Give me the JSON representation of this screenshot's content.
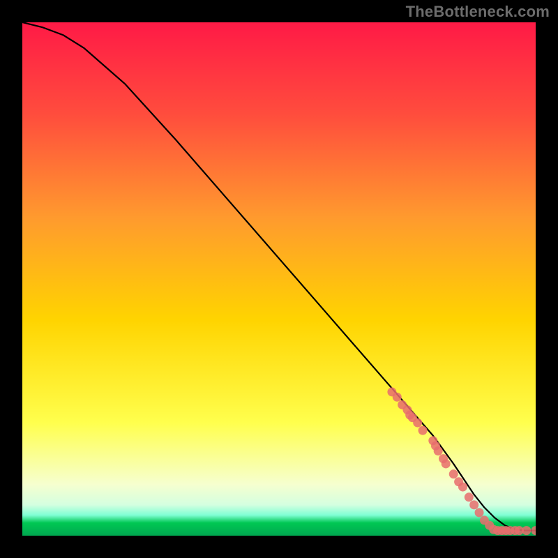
{
  "watermark": "TheBottleneck.com",
  "colors": {
    "background": "#000000",
    "watermark_text": "#6c6c6c",
    "gradient_top": "#ff1a46",
    "gradient_mid_upper": "#ff7a34",
    "gradient_mid": "#ffd400",
    "gradient_mid_lower": "#ffff4d",
    "gradient_lower": "#f6ffcf",
    "gradient_band": "#7fffd4",
    "gradient_green": "#00c853",
    "curve": "#000000",
    "markers": "#e86d6d"
  },
  "chart_data": {
    "type": "line",
    "title": "",
    "xlabel": "",
    "ylabel": "",
    "xlim": [
      0,
      100
    ],
    "ylim": [
      0,
      100
    ],
    "series": [
      {
        "name": "curve",
        "x": [
          0,
          4,
          8,
          12,
          20,
          30,
          40,
          50,
          60,
          70,
          80,
          84,
          86,
          88,
          90,
          92,
          94,
          96,
          98,
          100
        ],
        "y": [
          100,
          99,
          97.5,
          95,
          88,
          77,
          65.5,
          54,
          42.5,
          31,
          19.5,
          14,
          11,
          8,
          5.5,
          3.5,
          2,
          1.2,
          1,
          1
        ]
      }
    ],
    "markers": [
      {
        "x": 72.0,
        "y": 28.0
      },
      {
        "x": 73.0,
        "y": 27.0
      },
      {
        "x": 74.0,
        "y": 25.5
      },
      {
        "x": 75.0,
        "y": 24.5
      },
      {
        "x": 75.5,
        "y": 23.5
      },
      {
        "x": 76.0,
        "y": 23.0
      },
      {
        "x": 77.0,
        "y": 22.0
      },
      {
        "x": 78.0,
        "y": 20.5
      },
      {
        "x": 80.0,
        "y": 18.5
      },
      {
        "x": 80.5,
        "y": 17.5
      },
      {
        "x": 81.0,
        "y": 16.5
      },
      {
        "x": 82.0,
        "y": 15.0
      },
      {
        "x": 82.5,
        "y": 14.0
      },
      {
        "x": 84.0,
        "y": 12.0
      },
      {
        "x": 85.0,
        "y": 10.5
      },
      {
        "x": 85.8,
        "y": 9.5
      },
      {
        "x": 87.0,
        "y": 7.5
      },
      {
        "x": 88.0,
        "y": 6.0
      },
      {
        "x": 89.0,
        "y": 4.5
      },
      {
        "x": 90.0,
        "y": 3.0
      },
      {
        "x": 91.0,
        "y": 2.0
      },
      {
        "x": 91.8,
        "y": 1.2
      },
      {
        "x": 92.6,
        "y": 1.0
      },
      {
        "x": 93.4,
        "y": 1.0
      },
      {
        "x": 94.2,
        "y": 1.0
      },
      {
        "x": 95.0,
        "y": 1.0
      },
      {
        "x": 96.0,
        "y": 1.0
      },
      {
        "x": 96.8,
        "y": 1.0
      },
      {
        "x": 98.2,
        "y": 1.0
      },
      {
        "x": 100.0,
        "y": 1.0
      }
    ]
  }
}
